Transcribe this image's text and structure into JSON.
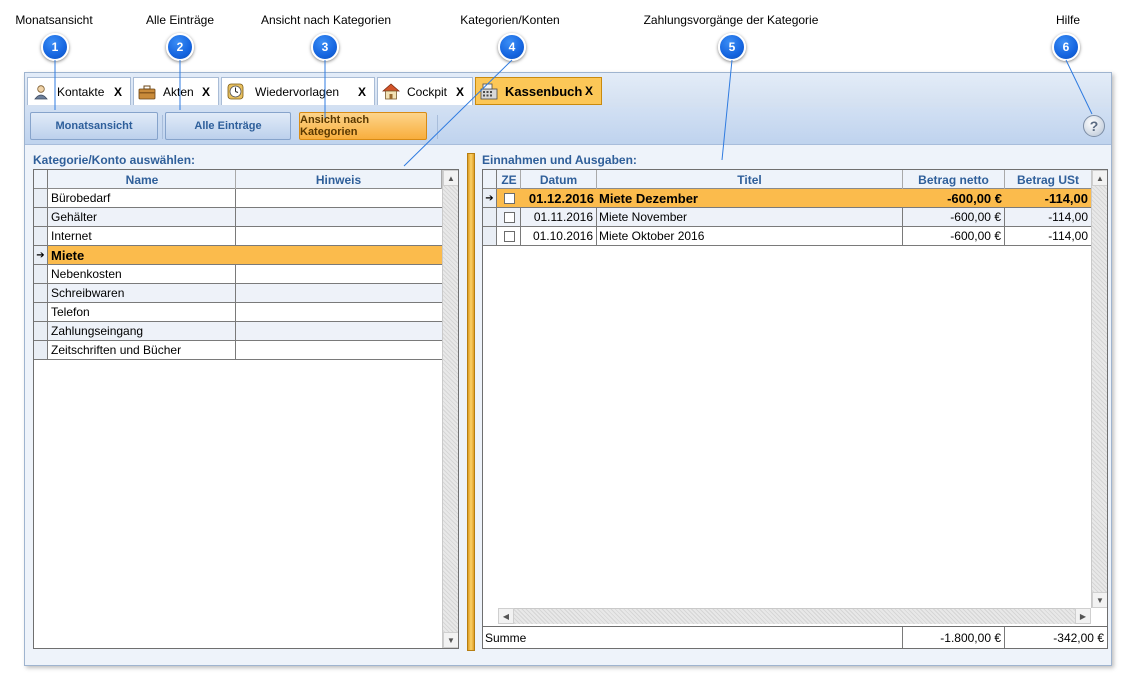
{
  "annotations": [
    {
      "number": "1",
      "label": "Monatsansicht"
    },
    {
      "number": "2",
      "label": "Alle Einträge"
    },
    {
      "number": "3",
      "label": "Ansicht nach Kategorien"
    },
    {
      "number": "4",
      "label": "Kategorien/Konten"
    },
    {
      "number": "5",
      "label": "Zahlungsvorgänge der Kategorie"
    },
    {
      "number": "6",
      "label": "Hilfe"
    }
  ],
  "tabs": [
    {
      "label": "Kontakte",
      "icon": "contact-person-icon",
      "close": "X"
    },
    {
      "label": "Akten",
      "icon": "briefcase-icon",
      "close": "X"
    },
    {
      "label": "Wiedervorlagen",
      "icon": "clock-icon",
      "close": "X"
    },
    {
      "label": "Cockpit",
      "icon": "house-icon",
      "close": "X"
    },
    {
      "label": "Kassenbuch",
      "icon": "cash-register-icon",
      "close": "X",
      "active": true
    }
  ],
  "toolbar": {
    "month_view": "Monatsansicht",
    "all_entries": "Alle Einträge",
    "by_category": "Ansicht nach Kategorien",
    "help": "?"
  },
  "left_panel": {
    "title": "Kategorie/Konto auswählen:",
    "columns": [
      "Name",
      "Hinweis"
    ],
    "rows": [
      {
        "name": "Bürobedarf",
        "note": ""
      },
      {
        "name": "Gehälter",
        "note": ""
      },
      {
        "name": "Internet",
        "note": ""
      },
      {
        "name": "Miete",
        "note": "",
        "selected": true
      },
      {
        "name": "Nebenkosten",
        "note": ""
      },
      {
        "name": "Schreibwaren",
        "note": ""
      },
      {
        "name": "Telefon",
        "note": ""
      },
      {
        "name": "Zahlungseingang",
        "note": ""
      },
      {
        "name": "Zeitschriften und Bücher",
        "note": ""
      }
    ]
  },
  "right_panel": {
    "title": "Einnahmen und Ausgaben:",
    "columns": [
      "ZE",
      "Datum",
      "Titel",
      "Betrag netto",
      "Betrag USt"
    ],
    "rows": [
      {
        "date": "01.12.2016",
        "title": "Miete Dezember",
        "net": "-600,00 €",
        "vat": "-114,00",
        "selected": true
      },
      {
        "date": "01.11.2016",
        "title": "Miete November",
        "net": "-600,00 €",
        "vat": "-114,00"
      },
      {
        "date": "01.10.2016",
        "title": "Miete Oktober 2016",
        "net": "-600,00 €",
        "vat": "-114,00"
      }
    ],
    "summary": {
      "label": "Summe",
      "net": "-1.800,00 €",
      "vat": "-342,00 €"
    }
  },
  "colors": {
    "accent": "#fbbb4c",
    "header_text": "#2f5f9a",
    "badge": "#1565e0"
  }
}
